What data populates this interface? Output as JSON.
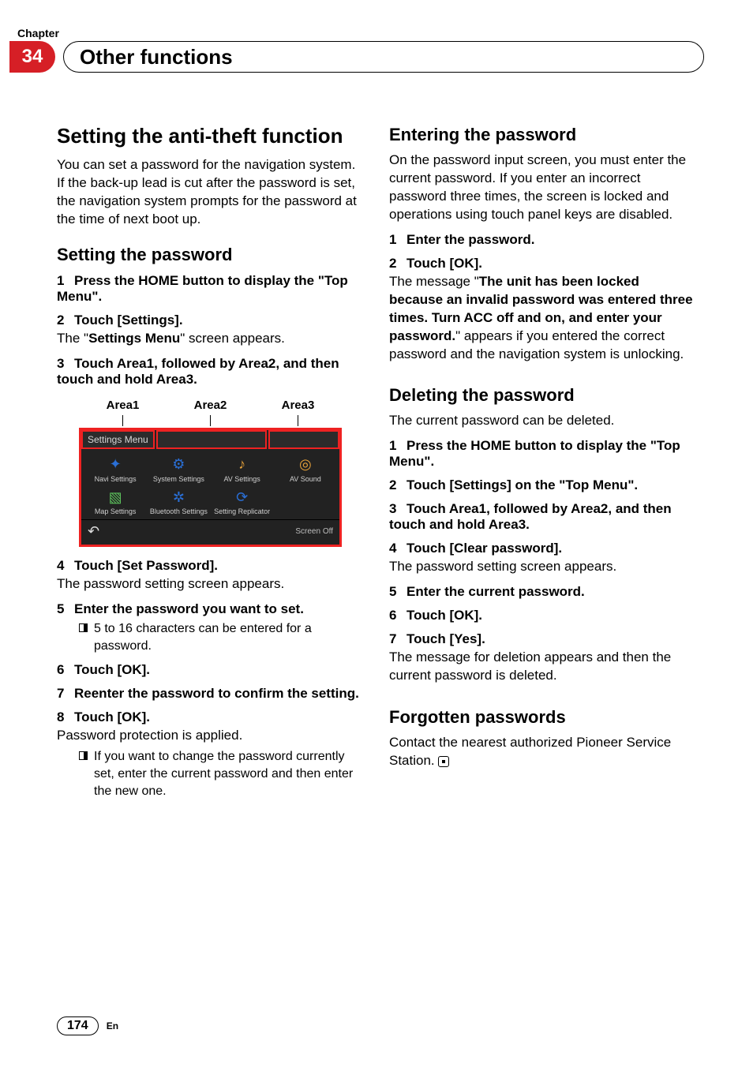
{
  "header": {
    "chapter_label": "Chapter",
    "chapter_number": "34",
    "chapter_title": "Other functions"
  },
  "left": {
    "h1": "Setting the anti-theft function",
    "intro": "You can set a password for the navigation system. If the back-up lead is cut after the password is set, the navigation system prompts for the password at the time of next boot up.",
    "sub1": "Setting the password",
    "s1": {
      "n": "1",
      "t": "Press the HOME button to display the \"Top Menu\"."
    },
    "s2": {
      "n": "2",
      "t": "Touch [Settings]."
    },
    "s2after_pre": "The \"",
    "s2after_b": "Settings Menu",
    "s2after_post": "\" screen appears.",
    "s3": {
      "n": "3",
      "t": "Touch Area1, followed by Area2, and then touch and hold Area3."
    },
    "areas": {
      "a1": "Area1",
      "a2": "Area2",
      "a3": "Area3"
    },
    "shot": {
      "tab": "Settings Menu",
      "icons": [
        {
          "lbl": "Navi Settings"
        },
        {
          "lbl": "System Settings"
        },
        {
          "lbl": "AV Settings"
        },
        {
          "lbl": "AV Sound"
        },
        {
          "lbl": "Map Settings"
        },
        {
          "lbl": "Bluetooth Settings"
        },
        {
          "lbl": "Setting Replicator"
        },
        {
          "lbl": ""
        }
      ],
      "screen_off": "Screen Off"
    },
    "s4": {
      "n": "4",
      "t": "Touch [Set Password]."
    },
    "s4after": "The password setting screen appears.",
    "s5": {
      "n": "5",
      "t": "Enter the password you want to set."
    },
    "s5b": "5 to 16 characters can be entered for a password.",
    "s6": {
      "n": "6",
      "t": "Touch [OK]."
    },
    "s7": {
      "n": "7",
      "t": "Reenter the password to confirm the setting."
    },
    "s8": {
      "n": "8",
      "t": "Touch [OK]."
    },
    "s8after": "Password protection is applied.",
    "s8b": "If you want to change the password currently set, enter the current password and then enter the new one."
  },
  "right": {
    "sub1": "Entering the password",
    "p1": "On the password input screen, you must enter the current password. If you enter an incorrect password three times, the screen is locked and operations using touch panel keys are disabled.",
    "r1": {
      "n": "1",
      "t": "Enter the password."
    },
    "r2": {
      "n": "2",
      "t": "Touch [OK]."
    },
    "r2after_pre": "The message \"",
    "r2after_b": "The unit has been locked because an invalid password was entered three times. Turn ACC off and on, and enter your password.",
    "r2after_post": "\" appears if you entered the correct password and the navigation system is unlocking.",
    "sub2": "Deleting the password",
    "p2": "The current password can be deleted.",
    "d1": {
      "n": "1",
      "t": "Press the HOME button to display the \"Top Menu\"."
    },
    "d2": {
      "n": "2",
      "t": "Touch [Settings] on the \"Top Menu\"."
    },
    "d3": {
      "n": "3",
      "t": "Touch Area1, followed by Area2, and then touch and hold Area3."
    },
    "d4": {
      "n": "4",
      "t": "Touch [Clear password]."
    },
    "d4after": "The password setting screen appears.",
    "d5": {
      "n": "5",
      "t": "Enter the current password."
    },
    "d6": {
      "n": "6",
      "t": "Touch [OK]."
    },
    "d7": {
      "n": "7",
      "t": "Touch [Yes]."
    },
    "d7after": "The message for deletion appears and then the current password is deleted.",
    "sub3": "Forgotten passwords",
    "p3": "Contact the nearest authorized Pioneer Service Station."
  },
  "footer": {
    "page": "174",
    "lang": "En"
  }
}
